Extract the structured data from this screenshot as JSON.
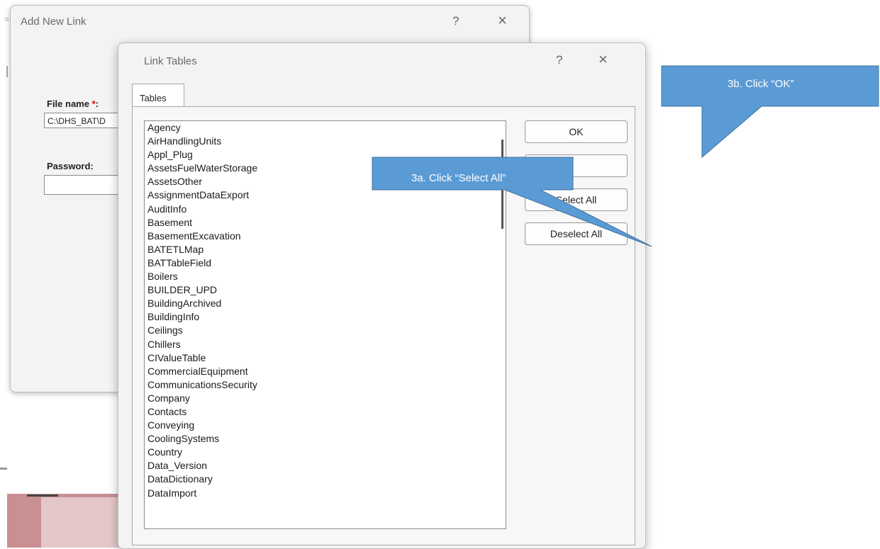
{
  "background_dialog": {
    "title": "Add New Link",
    "help": "?",
    "close": "×",
    "file_name_label": "File name",
    "required_mark": "*",
    "colon": ":",
    "file_name_value": "C:\\DHS_BAT\\D",
    "password_label": "Password:",
    "password_value": ""
  },
  "dialog": {
    "title": "Link Tables",
    "help": "?",
    "close": "×",
    "tab": "Tables",
    "buttons": {
      "ok": "OK",
      "cancel": "",
      "select_all": "Select All",
      "deselect_all": "Deselect All"
    },
    "tables": [
      "Agency",
      "AirHandlingUnits",
      "Appl_Plug",
      "AssetsFuelWaterStorage",
      "AssetsOther",
      "AssignmentDataExport",
      "AuditInfo",
      "Basement",
      "BasementExcavation",
      "BATETLMap",
      "BATTableField",
      "Boilers",
      "BUILDER_UPD",
      "BuildingArchived",
      "BuildingInfo",
      "Ceilings",
      "Chillers",
      "CIValueTable",
      "CommercialEquipment",
      "CommunicationsSecurity",
      "Company",
      "Contacts",
      "Conveying",
      "CoolingSystems",
      "Country",
      "Data_Version",
      "DataDictionary",
      "DataImport"
    ]
  },
  "annotations": {
    "select_all_callout": "3a. Click “Select All”",
    "ok_callout": "3b. Click “OK”",
    "callout_color": "#5b9bd5"
  }
}
